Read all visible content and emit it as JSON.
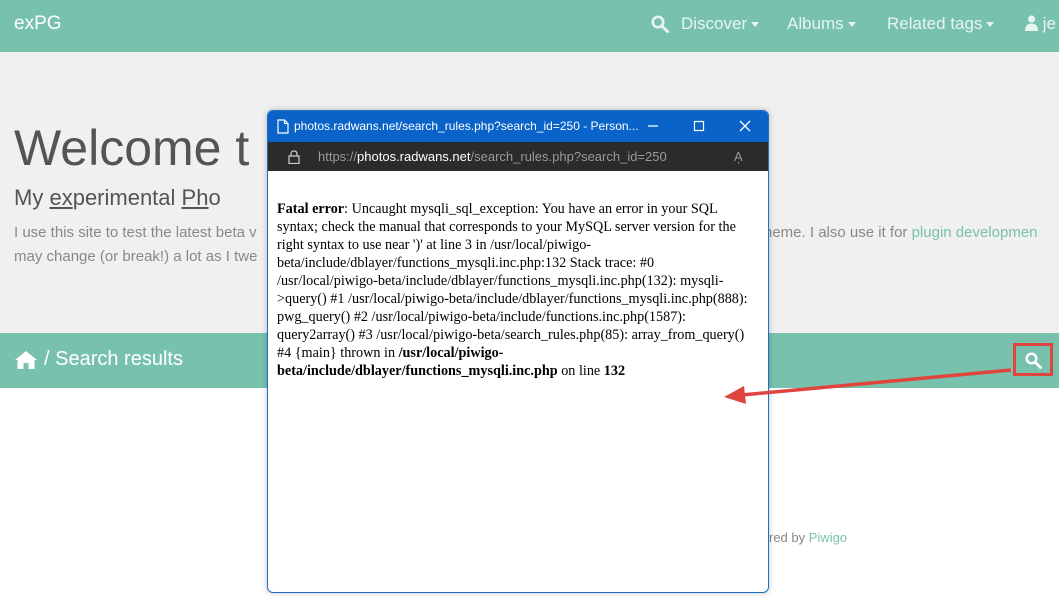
{
  "navbar": {
    "brand": "exPG",
    "items": [
      {
        "label": "Discover"
      },
      {
        "label": "Albums"
      },
      {
        "label": "Related tags"
      }
    ],
    "user_label": "je"
  },
  "jumbotron": {
    "title": "Welcome t",
    "subtitle_pre": "My ",
    "subtitle_ex": "ex",
    "subtitle_mid": "perimental ",
    "subtitle_ph": "Ph",
    "subtitle_post": "o",
    "desc_line1_left": "I use this site to test the latest beta v",
    "desc_line1_right": "heme. I also use it for ",
    "desc_line1_link": "plugin developmen",
    "desc_line2": "may change (or break!) a lot as I twe"
  },
  "breadcrumb": {
    "text": "/ Search results"
  },
  "footer": {
    "prefix": "red by ",
    "link": "Piwigo"
  },
  "popup": {
    "title": "photos.radwans.net/search_rules.php?search_id=250 - Person...",
    "address_prefix": "https://",
    "address_host": "photos.radwans.net",
    "address_path": "/search_rules.php?search_id=250",
    "read_aloud": "Aͅ",
    "error_label": "Fatal error",
    "error_message": ": Uncaught mysqli_sql_exception: You have an error in your SQL syntax; check the manual that corresponds to your MySQL server version for the right syntax to use near ')' at line 3 in /usr/local/piwigo-beta/include/dblayer/functions_mysqli.inc.php:132 Stack trace: #0 /usr/local/piwigo-beta/include/dblayer/functions_mysqli.inc.php(132): mysqli->query() #1 /usr/local/piwigo-beta/include/dblayer/functions_mysqli.inc.php(888): pwg_query() #2 /usr/local/piwigo-beta/include/functions.inc.php(1587): query2array() #3 /usr/local/piwigo-beta/search_rules.php(85): array_from_query() #4 {main} thrown in ",
    "error_file": "/usr/local/piwigo-beta/include/dblayer/functions_mysqli.inc.php",
    "error_online": " on line ",
    "error_line": "132"
  },
  "colors": {
    "accent": "#78c2ad",
    "annotation": "#e0443f",
    "popup_titlebar": "#0a63c9"
  }
}
